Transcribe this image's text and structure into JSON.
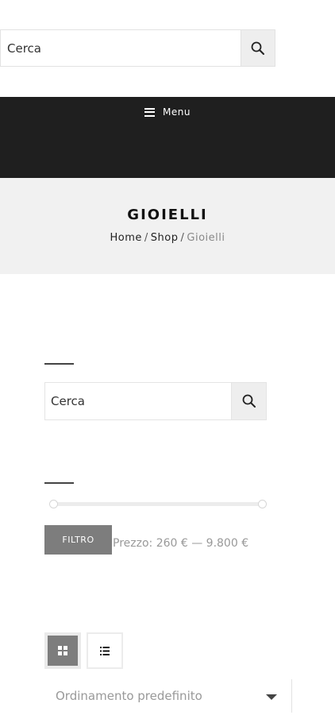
{
  "header_search": {
    "placeholder": "Cerca",
    "icon": "search-icon"
  },
  "menu": {
    "label": "Menu",
    "icon": "hamburger-icon",
    "background": "#1f1f1f"
  },
  "page": {
    "title": "GIOIELLI",
    "breadcrumb": [
      {
        "label": "Home"
      },
      {
        "label": "Shop"
      },
      {
        "label": "Gioielli"
      }
    ],
    "separator": "/"
  },
  "sidebar": {
    "search": {
      "placeholder": "Cerca",
      "icon": "search-icon"
    },
    "price_filter": {
      "button_label": "FILTRO",
      "price_text": "Prezzo: 260 € — 9.800 €",
      "min": 260,
      "max": 9800
    }
  },
  "toolbar": {
    "view_modes": [
      "grid",
      "list"
    ],
    "active_view": "grid",
    "sort_selected": "Ordinamento predefinito"
  },
  "colors": {
    "button_gray": "#7d7d7d",
    "title_band": "#f1f1f1"
  }
}
